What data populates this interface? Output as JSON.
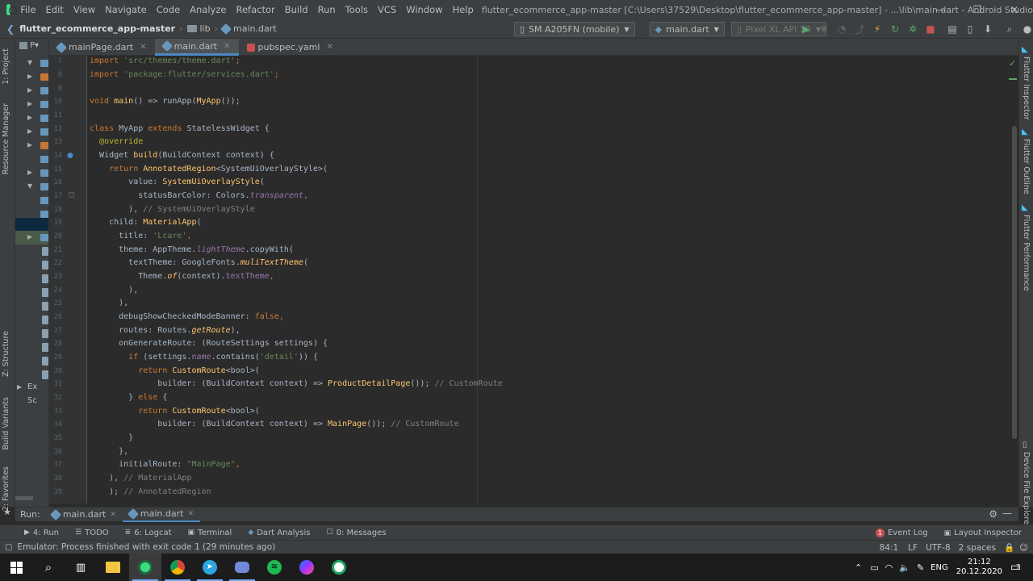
{
  "menubar": {
    "items": [
      "File",
      "Edit",
      "View",
      "Navigate",
      "Code",
      "Analyze",
      "Refactor",
      "Build",
      "Run",
      "Tools",
      "VCS",
      "Window",
      "Help"
    ],
    "title": "flutter_ecommerce_app-master [C:\\Users\\37529\\Desktop\\flutter_ecommerce_app-master] - ...\\lib\\main.dart - Android Studio",
    "controls": [
      "—",
      "❐",
      "✕"
    ]
  },
  "navbar": {
    "project": "flutter_ecommerce_app-master",
    "folder": "lib",
    "file": "main.dart",
    "device": "SM A205FN (mobile)",
    "config": "main.dart",
    "avd": "Pixel XL API 30"
  },
  "left_panel": {
    "tab_abbrev": "P▾",
    "tree_label_1": "flu",
    "tree_label_2": "Ex",
    "tree_label_3": "Sc"
  },
  "left_tool_tabs": [
    "1: Project",
    "Resource Manager",
    "Z: Structure",
    "Build Variants",
    "2: Favorites"
  ],
  "right_tool_tabs": [
    "Flutter Inspector",
    "Flutter Outline",
    "Flutter Performance",
    "Device File Explorer"
  ],
  "tabs": [
    {
      "label": "mainPage.dart",
      "active": false
    },
    {
      "label": "main.dart",
      "active": true
    },
    {
      "label": "pubspec.yaml",
      "active": false
    }
  ],
  "code": {
    "line_numbers": [
      "7",
      "8",
      "9",
      "10",
      "11",
      "12",
      "13",
      "14",
      "15",
      "16",
      "17",
      "18",
      "19",
      "20",
      "21",
      "22",
      "23",
      "24",
      "25",
      "26",
      "27",
      "28",
      "29",
      "30",
      "31",
      "32",
      "33",
      "34",
      "35",
      "36",
      "37",
      "38",
      "39"
    ],
    "t": {
      "import": "import",
      "theme_path": "'src/themes/theme.dart'",
      "services_path": "'package:flutter/services.dart'",
      "semi": ";",
      "void": "void",
      "main": "main",
      "main_rest": "() => runApp(",
      "MyApp": "MyApp",
      "close_call": "());",
      "class": "class",
      "myapp_name": " MyApp ",
      "extends": "extends",
      "stateless": " StatelessWidget {",
      "override": "@override",
      "widget": "Widget ",
      "build": "build",
      "build_args": "(BuildContext context) {",
      "return": "return",
      "annotated": "AnnotatedRegion",
      "annot_type": "<SystemUiOverlayStyle>(",
      "value_lbl": "value: ",
      "sysui": "SystemUiOverlayStyle",
      "paren": "(",
      "statusbar": "statusBarColor: Colors.",
      "transparent": "transparent",
      "comma": ",",
      "close_paren_comma": "),",
      "cmt_sysui": " // SystemUiOverlayStyle",
      "child": "child: ",
      "material": "MaterialApp",
      "title_lbl": "title: ",
      "lcare": "'Lcare'",
      "theme_lbl": "theme: AppTheme.",
      "lighttheme": "lightTheme",
      "copywith": ".copyWith(",
      "texttheme_lbl": "textTheme: GoogleFonts.",
      "muli": "muliTextTheme",
      "theme_cls": "Theme.",
      "of": "of",
      "ctx": "(context).",
      "texttheme_prop": "textTheme",
      "debug": "debugShowCheckedModeBanner: ",
      "false": "false",
      "routes": "routes: Routes.",
      "getroute": "getRoute",
      "ongen": "onGenerateRoute: (RouteSettings settings) {",
      "if": "if",
      "cond1": " (settings.",
      "name": "name",
      "cond2": ".contains(",
      "detail": "'detail'",
      "cond3": ")) {",
      "customroute": "CustomRoute",
      "bool_paren": "<bool>(",
      "builder_lbl": "builder: (BuildContext context) => ",
      "pdp": "ProductDetailPage",
      "call_end": "());",
      "cmt_customroute": " // CustomRoute",
      "close_brace": "}",
      "else_open": "} ",
      "else": "else",
      "brace_open": " {",
      "mainpage": "MainPage",
      "close_brace_comma": "},",
      "initialroute": "initialRoute: ",
      "mainpage_str": "\"MainPage\"",
      "cmt_material": " // MaterialApp",
      "close_semi": ");",
      "cmt_annotated": " // AnnotatedRegion"
    }
  },
  "runbar": {
    "label": "Run:",
    "tabs": [
      "main.dart",
      "main.dart"
    ]
  },
  "toolwindows": [
    {
      "label": "4: Run",
      "icon": "▶"
    },
    {
      "label": "TODO",
      "icon": "☰"
    },
    {
      "label": "6: Logcat",
      "icon": "≣"
    },
    {
      "label": "Terminal",
      "icon": "▣"
    },
    {
      "label": "Dart Analysis",
      "icon": "◆"
    },
    {
      "label": "0: Messages",
      "icon": "☐"
    }
  ],
  "toolwindows_right": [
    {
      "label": "Event Log",
      "badge": "1"
    },
    {
      "label": "Layout Inspector"
    }
  ],
  "status": {
    "message": "Emulator: Process finished with exit code 1 (29 minutes ago)",
    "position": "84:1",
    "line_sep": "LF",
    "encoding": "UTF-8",
    "indent": "2 spaces"
  },
  "taskbar": {
    "apps": [
      "windows-start",
      "search",
      "task-view",
      "android-studio",
      "chrome",
      "telegram",
      "files",
      "discord",
      "spotify",
      "messenger",
      "other-app"
    ],
    "lang": "ENG",
    "time": "21:12",
    "date": "20.12.2020",
    "notifications": "7"
  }
}
